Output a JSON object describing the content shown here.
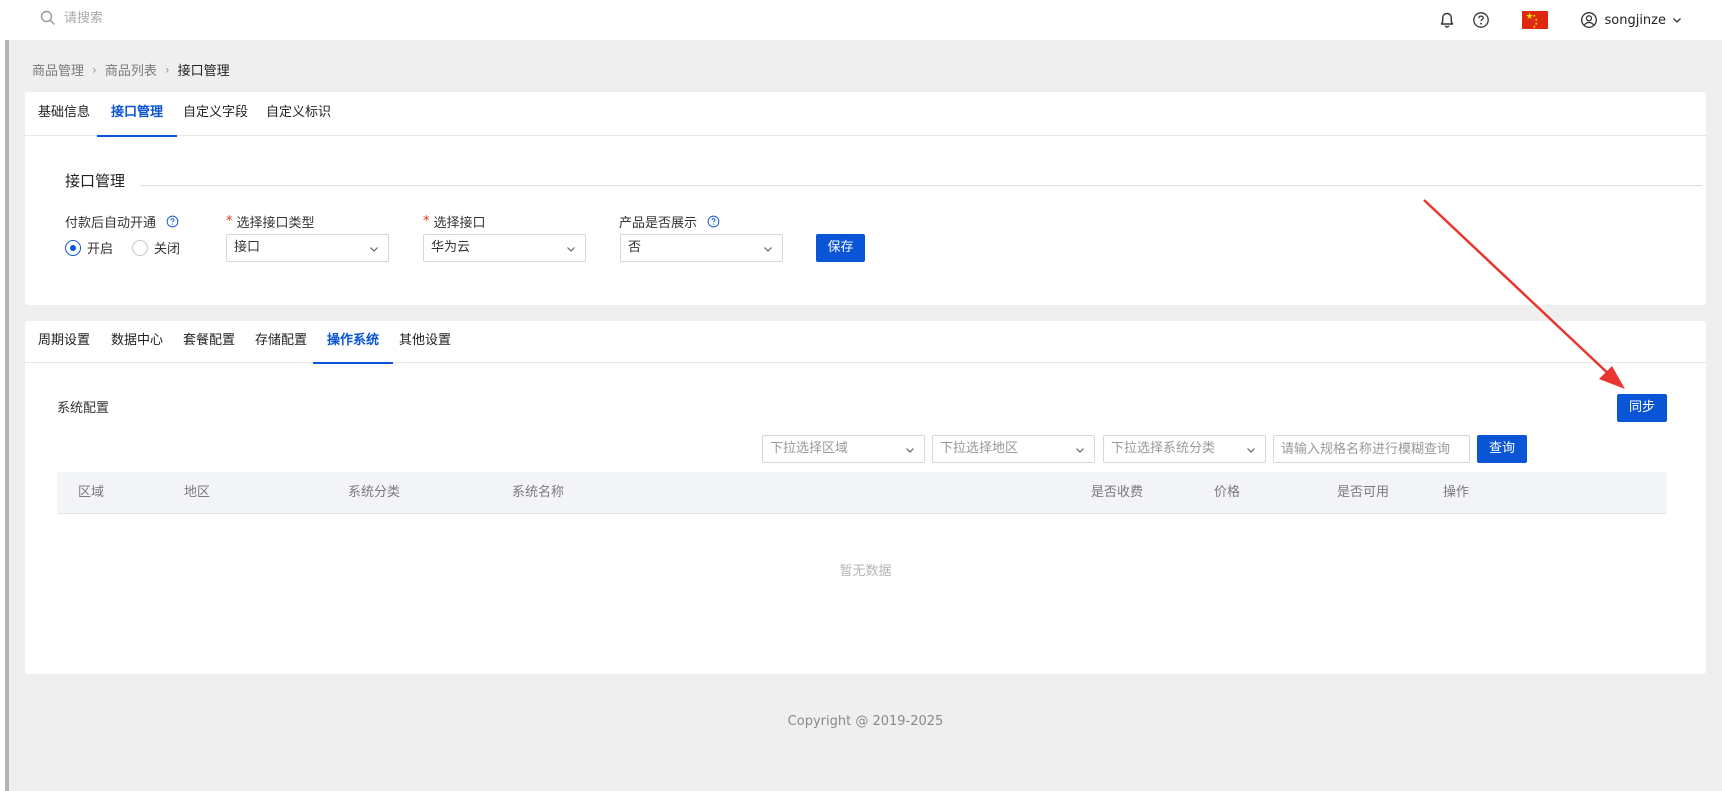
{
  "topbar": {
    "search_placeholder": "请搜索",
    "username": "songjinze"
  },
  "breadcrumb": [
    "商品管理",
    "商品列表",
    "接口管理"
  ],
  "top_tabs": [
    {
      "label": "基础信息",
      "active": false
    },
    {
      "label": "接口管理",
      "active": true
    },
    {
      "label": "自定义字段",
      "active": false
    },
    {
      "label": "自定义标识",
      "active": false
    }
  ],
  "interface": {
    "section_title": "接口管理",
    "auto_open": {
      "label": "付款后自动开通",
      "options": [
        {
          "label": "开启",
          "selected": true
        },
        {
          "label": "关闭",
          "selected": false
        }
      ]
    },
    "interface_type": {
      "required_mark": "*",
      "label": "选择接口类型",
      "value": "接口"
    },
    "interface": {
      "required_mark": "*",
      "label": "选择接口",
      "value": "华为云"
    },
    "display": {
      "label": "产品是否展示",
      "value": "否"
    },
    "save_label": "保存"
  },
  "sub_tabs": [
    {
      "label": "周期设置",
      "active": false
    },
    {
      "label": "数据中心",
      "active": false
    },
    {
      "label": "套餐配置",
      "active": false
    },
    {
      "label": "存储配置",
      "active": false
    },
    {
      "label": "操作系统",
      "active": true
    },
    {
      "label": "其他设置",
      "active": false
    }
  ],
  "os_config": {
    "title": "系统配置",
    "sync_label": "同步",
    "filters": {
      "region_placeholder": "下拉选择区域",
      "area_placeholder": "下拉选择地区",
      "category_placeholder": "下拉选择系统分类",
      "name_placeholder": "请输入规格名称进行模糊查询",
      "query_label": "查询"
    },
    "columns": [
      "区域",
      "地区",
      "系统分类",
      "系统名称",
      "是否收费",
      "价格",
      "是否可用",
      "操作"
    ],
    "empty_text": "暂无数据"
  },
  "footer": {
    "copyright": "Copyright @ 2019-2025"
  },
  "colors": {
    "primary": "#0a55d6",
    "annotation_arrow": "#e8362e",
    "flag": "#de2910"
  }
}
